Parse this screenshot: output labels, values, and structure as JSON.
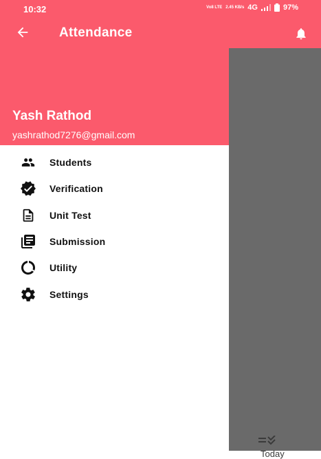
{
  "status_bar": {
    "time": "10:32",
    "volte": "Vo8 LTE",
    "speed": "2.45 KB/s",
    "network": "4G",
    "battery": "97%"
  },
  "app_bar": {
    "title": "Attendance",
    "back_icon": "arrow-left-icon",
    "notification_icon": "bell-icon"
  },
  "drawer": {
    "user": {
      "name": "Yash Rathod",
      "email": "yashrathod7276@gmail.com"
    },
    "items": [
      {
        "label": "Students",
        "icon": "people-icon"
      },
      {
        "label": "Verification",
        "icon": "verified-badge-icon"
      },
      {
        "label": "Unit Test",
        "icon": "document-icon"
      },
      {
        "label": "Submission",
        "icon": "library-books-icon"
      },
      {
        "label": "Utility",
        "icon": "circle-progress-icon"
      },
      {
        "label": "Settings",
        "icon": "gear-icon"
      }
    ]
  },
  "bottom_nav": {
    "today_label": "Today",
    "today_icon": "checklist-icon"
  },
  "colors": {
    "accent": "#fb5a6c",
    "scrim": "#6a6a6a"
  }
}
